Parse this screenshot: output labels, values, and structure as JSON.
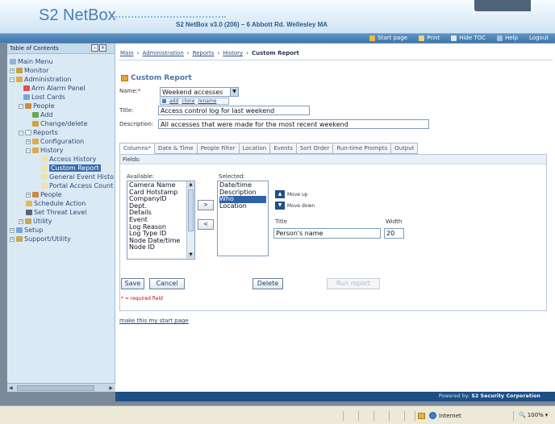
{
  "app": {
    "logo": "S2 NetBox",
    "title": "S2 NetBox v3.0 (206) – 6 Abbott Rd. Wellesley MA"
  },
  "toolbar": {
    "start_page": "Start page",
    "print": "Print",
    "hide_toc": "Hide TOC",
    "help": "Help",
    "logout": "Logout"
  },
  "sidebar": {
    "title": "Table of Contents",
    "items": [
      {
        "label": "Main Menu",
        "icon": "home-icon"
      },
      {
        "label": "Monitor",
        "icon": "monitor-icon"
      },
      {
        "label": "Administration",
        "icon": "folder-icon"
      },
      {
        "label": "Arm Alarm Panel",
        "icon": "alarm-icon"
      },
      {
        "label": "Lost Cards",
        "icon": "card-icon"
      },
      {
        "label": "People",
        "icon": "people-icon"
      },
      {
        "label": "Add",
        "icon": "add-person-icon"
      },
      {
        "label": "Change/delete",
        "icon": "edit-person-icon"
      },
      {
        "label": "Reports",
        "icon": "folder-icon"
      },
      {
        "label": "Configuration",
        "icon": "folder-icon"
      },
      {
        "label": "History",
        "icon": "folder-icon"
      },
      {
        "label": "Access History",
        "icon": "report-icon"
      },
      {
        "label": "Custom Report",
        "icon": "report-icon"
      },
      {
        "label": "General Event Histo",
        "icon": "report-icon"
      },
      {
        "label": "Portal Access Count",
        "icon": "report-icon"
      },
      {
        "label": "People",
        "icon": "folder-icon"
      },
      {
        "label": "Schedule Action",
        "icon": "schedule-icon"
      },
      {
        "label": "Set Threat Level",
        "icon": "threat-icon"
      },
      {
        "label": "Utility",
        "icon": "utility-icon"
      },
      {
        "label": "Setup",
        "icon": "setup-icon"
      },
      {
        "label": "Support/Utility",
        "icon": "support-icon"
      }
    ]
  },
  "breadcrumb": {
    "items": [
      "Main",
      "Administration",
      "Reports",
      "History"
    ],
    "current": "Custom Report"
  },
  "report": {
    "heading": "Custom Report",
    "name_label": "Name:",
    "name_value": "Weekend accesses",
    "name_actions": [
      "add",
      "clone",
      "rename"
    ],
    "title_label": "Title:",
    "title_value": "Access control log for last weekend",
    "description_label": "Description:",
    "description_value": "All accesses that were made for the most recent weekend"
  },
  "tabs": [
    "Columns*",
    "Date & Time",
    "People Filter",
    "Location",
    "Events",
    "Sort Order",
    "Run-time Prompts",
    "Output"
  ],
  "columns": {
    "fields_label": "Fields:",
    "available_label": "Available:",
    "available": [
      "Camera Name",
      "Card Hotstamp",
      "CompanyID",
      "Dept.",
      "Details",
      "Event",
      "Log Reason",
      "Log Type ID",
      "Node Date/time",
      "Node ID"
    ],
    "selected_label": "Selected:",
    "selected": [
      "Date/time",
      "Description",
      "Who",
      "Location"
    ],
    "selected_item": "Who",
    "add_button": ">",
    "remove_button": "<",
    "move_up": "Move up",
    "move_down": "Move down",
    "title_col_label": "Title",
    "width_col_label": "Width",
    "title_col_value": "Person's name",
    "width_col_value": "20"
  },
  "actions": {
    "save": "Save",
    "cancel": "Cancel",
    "delete": "Delete",
    "run_report": "Run report"
  },
  "required_note": "* = required field",
  "start_page_link": "make this my start page",
  "footer": {
    "powered_by": "Powered by:",
    "company": "S2 Security Corporation"
  },
  "statusbar": {
    "zone": "Internet",
    "zoom": "100%"
  },
  "colors": {
    "brand_blue": "#3e78ad",
    "sidebar_bg": "#dbe9f5",
    "footer_bg": "#1d4f86",
    "selected_bg": "#3062a8"
  }
}
